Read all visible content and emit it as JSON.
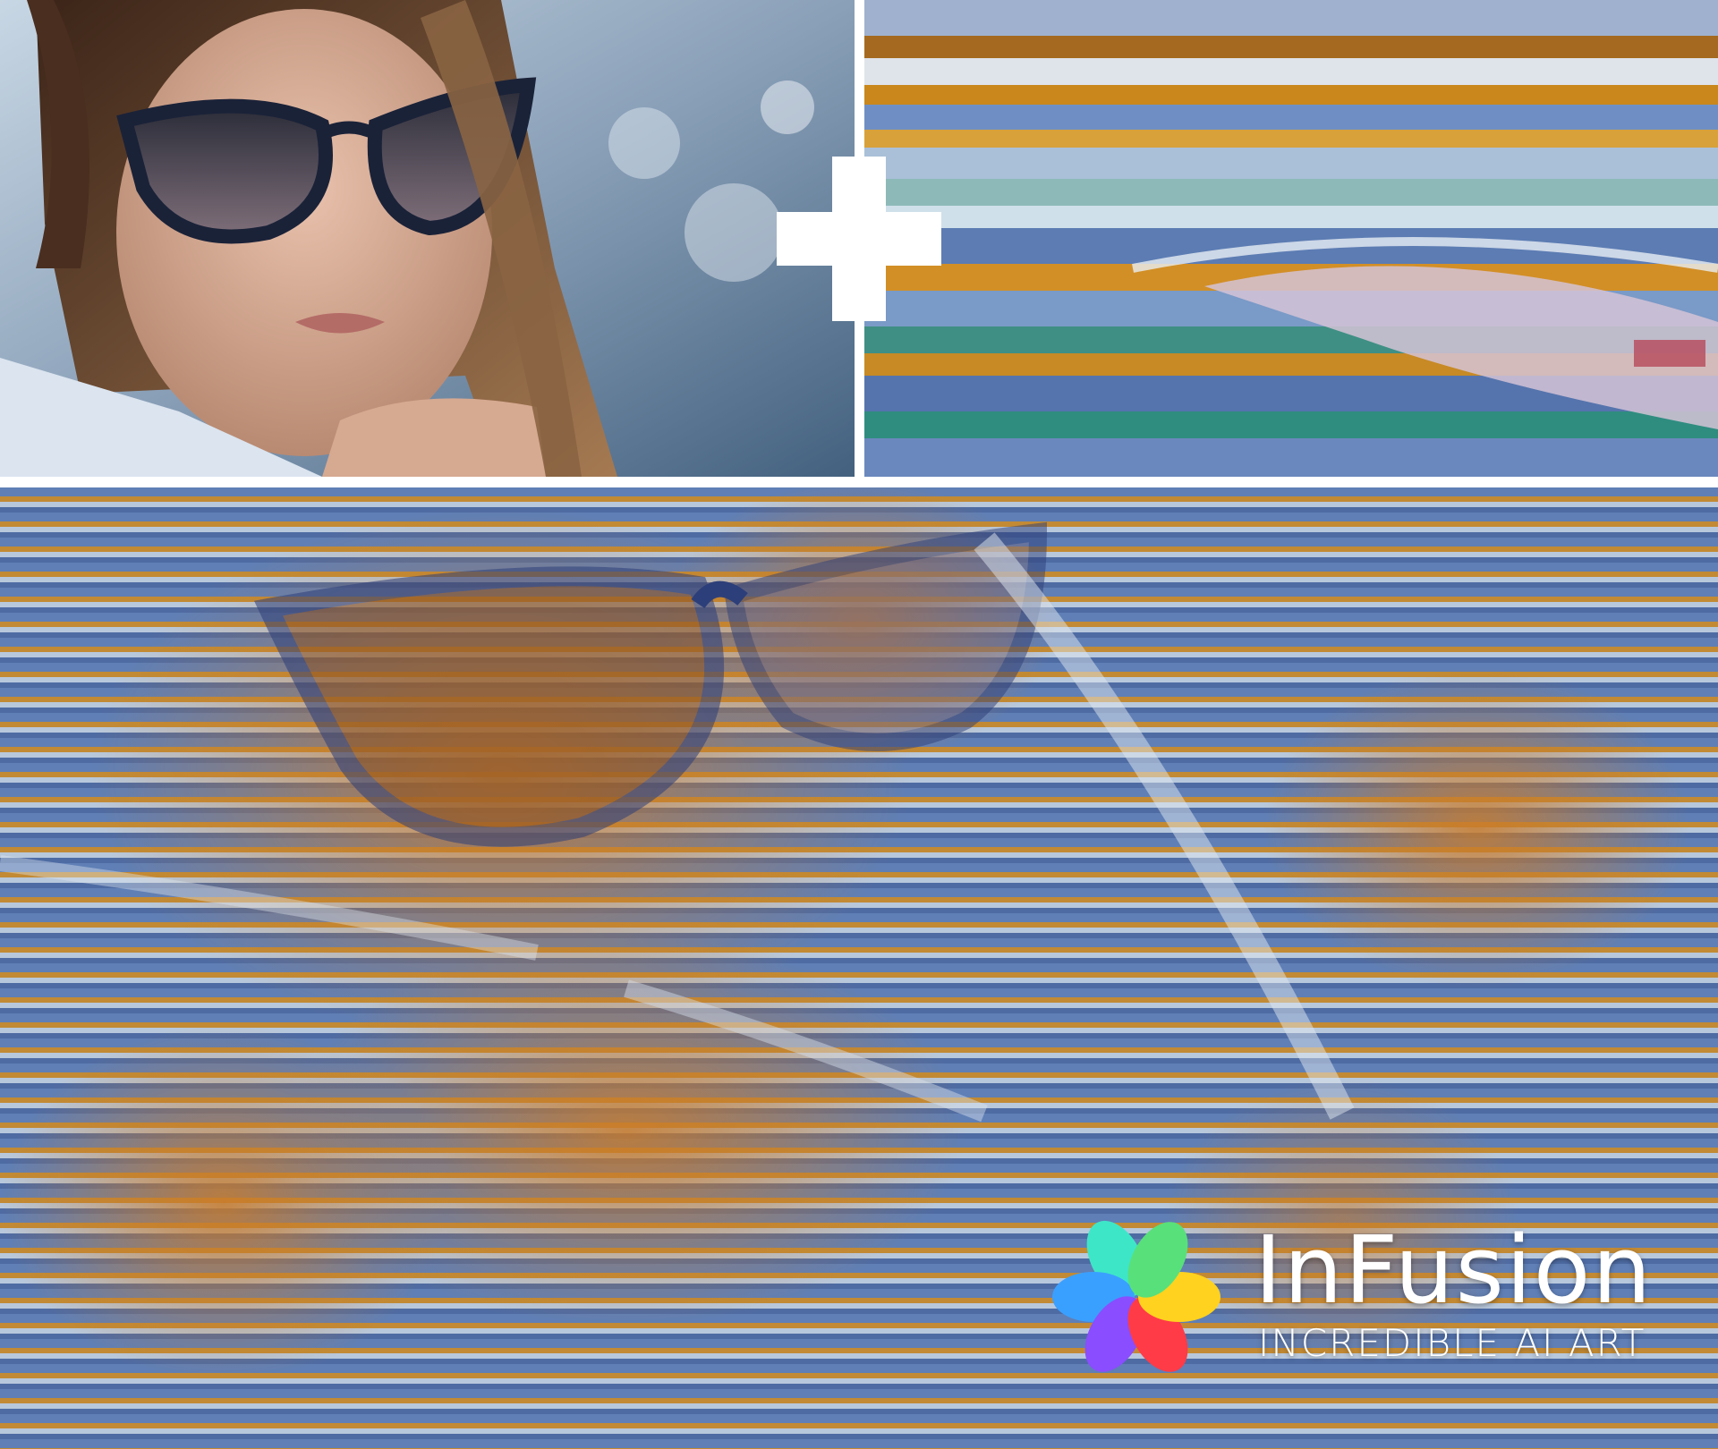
{
  "panels": {
    "photo": {
      "description_icon": "portrait-photo"
    },
    "painting": {
      "description_icon": "style-painting"
    },
    "result": {
      "description_icon": "stylized-result"
    }
  },
  "plus": {
    "icon": "plus-icon",
    "color": "#ffffff"
  },
  "logo": {
    "title": "InFusion",
    "tagline": "INCREDIBLE AI ART",
    "petal_colors": [
      "#3ee6c8",
      "#3aa0ff",
      "#8a4dff",
      "#ff3b47",
      "#ffd21f",
      "#58e07a"
    ]
  }
}
